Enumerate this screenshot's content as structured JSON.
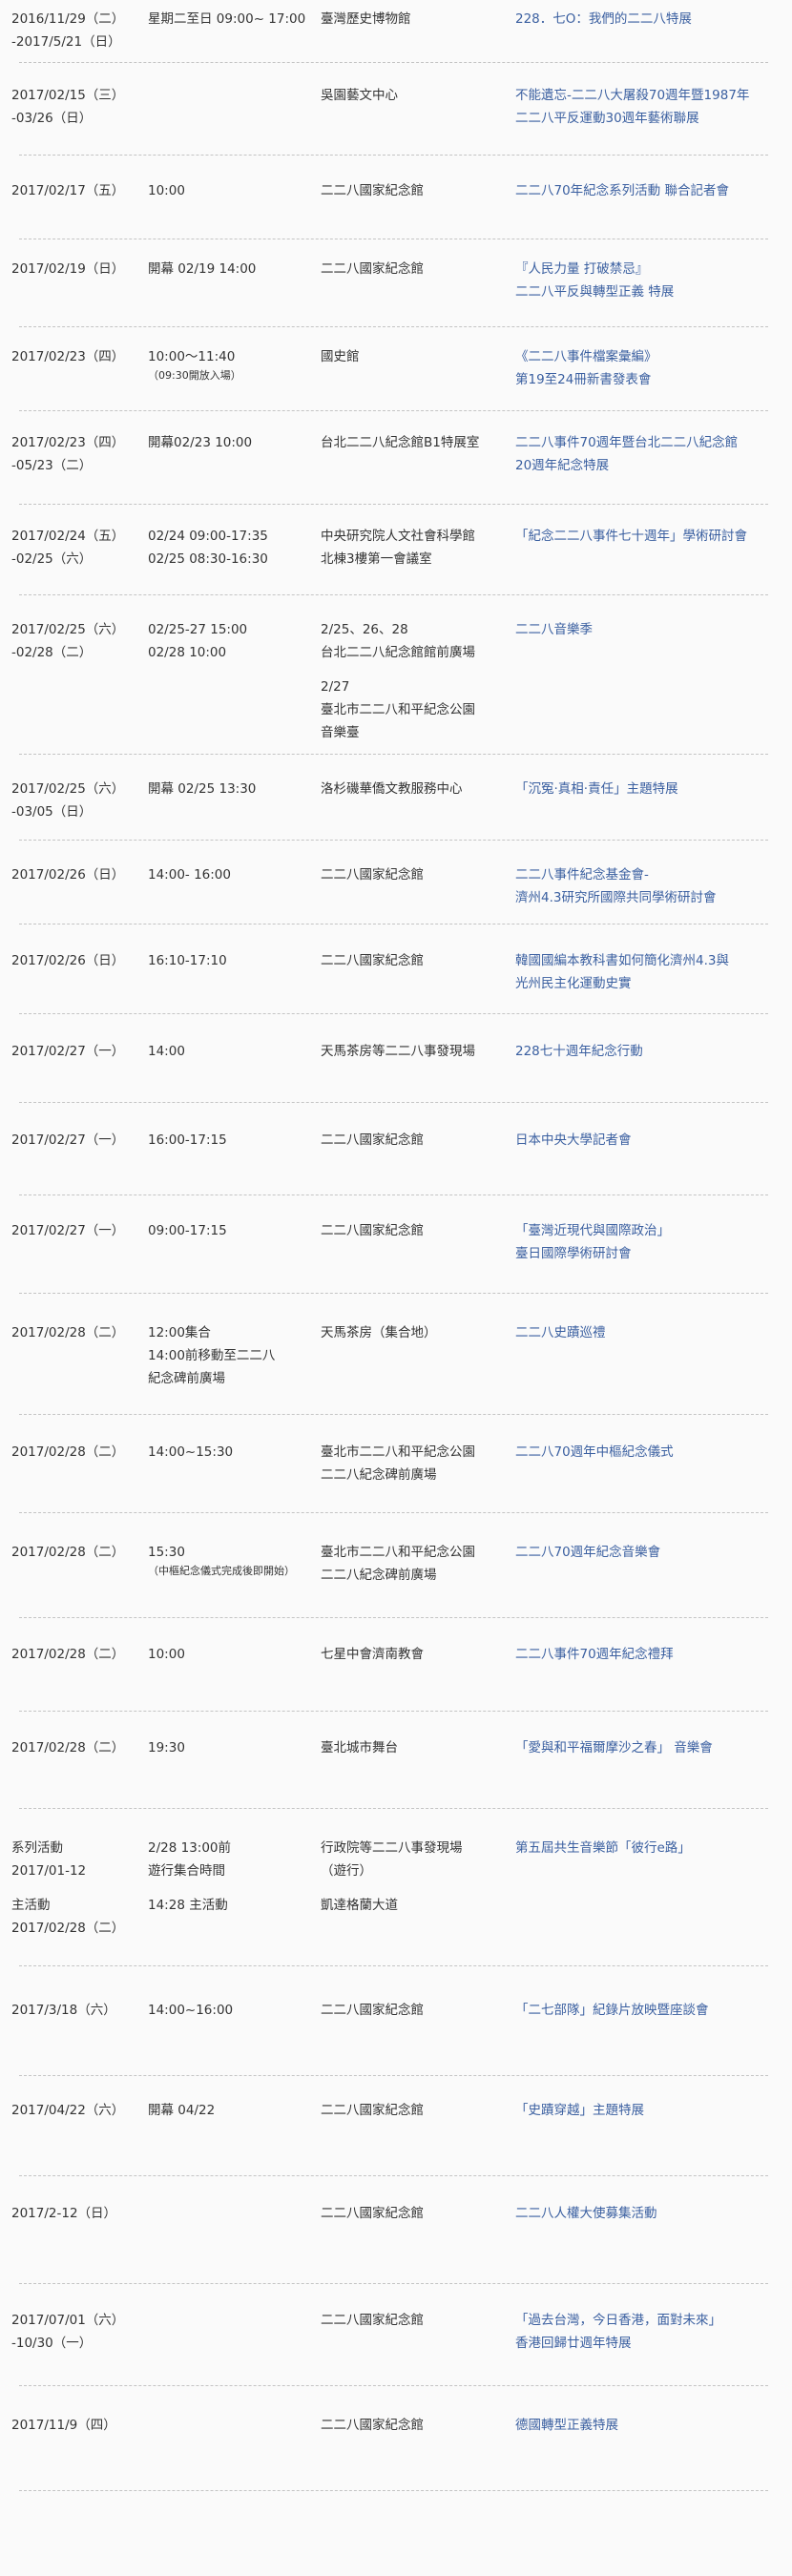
{
  "events": [
    {
      "date": [
        "2016/11/29（二）",
        "-2017/5/21（日）"
      ],
      "time": [
        "星期二至日 09:00~ 17:00"
      ],
      "location": [
        "臺灣歷史博物館"
      ],
      "title": [
        "228．七O：我們的二二八特展"
      ]
    },
    {
      "date": [
        "2017/02/15（三）",
        "-03/26（日）"
      ],
      "time": [],
      "location": [
        "吳園藝文中心"
      ],
      "title": [
        "不能遺忘-二二八大屠殺70週年暨1987年",
        "二二八平反運動30週年藝術聯展"
      ]
    },
    {
      "date": [
        "2017/02/17（五）"
      ],
      "time": [
        "10:00"
      ],
      "location": [
        "二二八國家紀念館"
      ],
      "title": [
        "二二八70年紀念系列活動 聯合記者會"
      ]
    },
    {
      "date": [
        "2017/02/19（日）"
      ],
      "time": [
        "開幕 02/19  14:00"
      ],
      "location": [
        "二二八國家紀念館"
      ],
      "title": [
        "『人民力量 打破禁忌』",
        "二二八平反與轉型正義 特展"
      ]
    },
    {
      "date": [
        "2017/02/23（四）"
      ],
      "time": [
        "10:00～11:40"
      ],
      "time_note": "（09:30開放入場）",
      "location": [
        "國史館"
      ],
      "title": [
        "《二二八事件檔案彙編》",
        "第19至24冊新書發表會"
      ]
    },
    {
      "date": [
        "2017/02/23（四）",
        "-05/23（二）"
      ],
      "time": [
        "開幕02/23  10:00"
      ],
      "location": [
        "台北二二八紀念館B1特展室"
      ],
      "title": [
        "二二八事件70週年暨台北二二八紀念館",
        "20週年紀念特展"
      ]
    },
    {
      "date": [
        "2017/02/24（五）",
        "-02/25（六）"
      ],
      "time": [
        "02/24   09:00-17:35",
        "02/25   08:30-16:30"
      ],
      "location": [
        "中央研究院人文社會科學館",
        "北棟3樓第一會議室"
      ],
      "title": [
        "「紀念二二八事件七十週年」學術研討會"
      ]
    },
    {
      "date": [
        "2017/02/25（六）",
        "-02/28（二）"
      ],
      "time": [
        "02/25-27   15:00",
        "02/28   10:00"
      ],
      "location": [
        "2/25、26、28",
        "台北二二八紀念館館前廣場",
        "",
        "2/27",
        "臺北市二二八和平紀念公園",
        "音樂臺"
      ],
      "title": [
        "二二八音樂季"
      ]
    },
    {
      "date": [
        "2017/02/25（六）",
        "-03/05（日）"
      ],
      "time": [
        "開幕 02/25  13:30"
      ],
      "location": [
        "洛杉磯華僑文教服務中心"
      ],
      "title": [
        "「沉冤·真相·責任」主題特展"
      ]
    },
    {
      "date": [
        "2017/02/26（日）"
      ],
      "time": [
        "14:00- 16:00"
      ],
      "location": [
        "二二八國家紀念館"
      ],
      "title": [
        "二二八事件紀念基金會-",
        "濟州4.3研究所國際共同學術研討會"
      ]
    },
    {
      "date": [
        "2017/02/26（日）"
      ],
      "time": [
        "16:10-17:10"
      ],
      "location": [
        "二二八國家紀念館"
      ],
      "title": [
        "韓國國編本教科書如何簡化濟州4.3與",
        "光州民主化運動史實"
      ]
    },
    {
      "date": [
        "2017/02/27（一）"
      ],
      "time": [
        "14:00"
      ],
      "location": [
        "天馬茶房等二二八事發現場"
      ],
      "title": [
        "228七十週年紀念行動"
      ]
    },
    {
      "date": [
        "2017/02/27（一）"
      ],
      "time": [
        "16:00-17:15"
      ],
      "location": [
        "二二八國家紀念館"
      ],
      "title": [
        "日本中央大學記者會"
      ]
    },
    {
      "date": [
        "2017/02/27（一）"
      ],
      "time": [
        "09:00-17:15"
      ],
      "location": [
        "二二八國家紀念館"
      ],
      "title": [
        "「臺灣近現代與國際政治」",
        "臺日國際學術研討會"
      ]
    },
    {
      "date": [
        "2017/02/28（二）"
      ],
      "time": [
        "12:00集合",
        "14:00前移動至二二八",
        "紀念碑前廣場"
      ],
      "location": [
        "天馬茶房（集合地）"
      ],
      "title": [
        "二二八史蹟巡禮"
      ]
    },
    {
      "date": [
        "2017/02/28（二）"
      ],
      "time": [
        "14:00~15:30"
      ],
      "location": [
        "臺北市二二八和平紀念公園",
        "二二八紀念碑前廣場"
      ],
      "title": [
        "二二八70週年中樞紀念儀式"
      ]
    },
    {
      "date": [
        "2017/02/28（二）"
      ],
      "time": [
        "15:30"
      ],
      "time_note": "（中樞紀念儀式完成後即開始）",
      "location": [
        "臺北市二二八和平紀念公園",
        "二二八紀念碑前廣場"
      ],
      "title": [
        "二二八70週年紀念音樂會"
      ]
    },
    {
      "date": [
        "2017/02/28（二）"
      ],
      "time": [
        "10:00"
      ],
      "location": [
        "七星中會濟南教會"
      ],
      "title": [
        "二二八事件70週年紀念禮拜"
      ]
    },
    {
      "date": [
        "2017/02/28（二）"
      ],
      "time": [
        "19:30"
      ],
      "location": [
        "臺北城市舞台"
      ],
      "title": [
        "「愛與和平福爾摩沙之春」 音樂會"
      ]
    },
    {
      "date": [
        "系列活動",
        "2017/01-12",
        "",
        "主活動",
        "2017/02/28（二）"
      ],
      "time": [
        "2/28  13:00前",
        "遊行集合時間",
        "",
        "14:28  主活動"
      ],
      "location": [
        "行政院等二二八事發現場",
        "（遊行）",
        "",
        "凱達格蘭大道"
      ],
      "title": [
        "第五屆共生音樂節「彼行e路」"
      ]
    },
    {
      "date": [
        "2017/3/18（六）"
      ],
      "time": [
        "14:00~16:00"
      ],
      "location": [
        "二二八國家紀念館"
      ],
      "title": [
        "「二七部隊」紀錄片放映暨座談會"
      ]
    },
    {
      "date": [
        "2017/04/22（六）"
      ],
      "time": [
        "開幕 04/22"
      ],
      "location": [
        "二二八國家紀念館"
      ],
      "title": [
        "「史蹟穿越」主題特展"
      ]
    },
    {
      "date": [
        "2017/2-12（日）"
      ],
      "time": [],
      "location": [
        "二二八國家紀念館"
      ],
      "title": [
        "二二八人權大使募集活動"
      ]
    },
    {
      "date": [
        "2017/07/01（六）",
        "-10/30（一）"
      ],
      "time": [],
      "location": [
        "二二八國家紀念館"
      ],
      "title": [
        "「過去台灣，今日香港，面對未來」",
        "香港回歸廿週年特展"
      ]
    },
    {
      "date": [
        "2017/11/9（四）"
      ],
      "time": [],
      "location": [
        "二二八國家紀念館"
      ],
      "title": [
        "德國轉型正義特展"
      ]
    }
  ],
  "colors": {
    "title_link": "#3a5fa0",
    "text": "#333333",
    "divider": "#c4c4c4",
    "background": "#fafafa"
  }
}
